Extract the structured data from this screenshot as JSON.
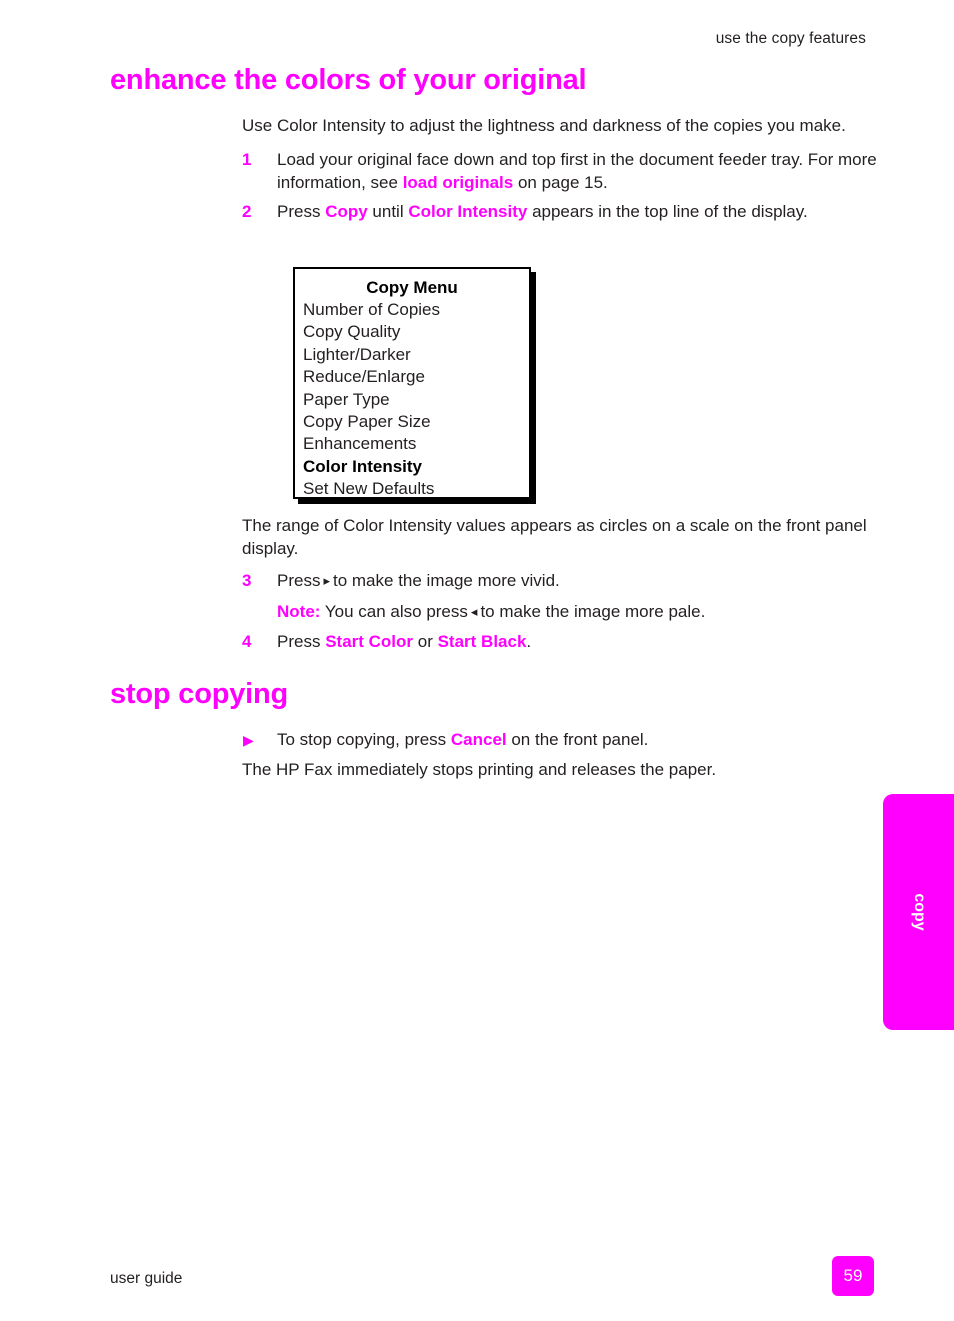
{
  "theme": {
    "accent": "#ff00ff",
    "text": "#231f20",
    "page_bg": "#ffffff"
  },
  "header": {
    "running_head": "use the copy features"
  },
  "sections": {
    "enhance": {
      "heading": "enhance the colors of your original",
      "intro": "Use Color Intensity to adjust the lightness and darkness of the copies you make.",
      "steps": [
        {
          "number": "1",
          "text_before": "Load your original face down and top first in the document feeder tray. For more information, see ",
          "link": "load originals",
          "text_after": " on page 15."
        },
        {
          "number": "2",
          "text_before": "Press ",
          "emph1": "Copy",
          "text_mid": " until ",
          "emph2": "Color Intensity",
          "text_after": " appears in the top line of the display."
        }
      ],
      "after_box_para": "The range of Color Intensity values appears as circles on a scale on the front panel display.",
      "step3": {
        "number": "3",
        "text_before": "Press",
        "arrow_icon": "▸",
        "text_after": "to make the image more vivid."
      },
      "note": {
        "label": "Note:",
        "text_before": " You can also press",
        "arrow_icon": "◂",
        "text_after": "to make the image more pale."
      },
      "step4": {
        "number": "4",
        "text_before": "Press ",
        "emph1": "Start Color",
        "text_mid": " or ",
        "emph2": "Start Black",
        "text_after": "."
      }
    },
    "stop": {
      "heading": "stop copying",
      "bullet": {
        "marker": "▶",
        "text_before": "To stop copying, press ",
        "emph": "Cancel",
        "text_after": " on the front panel."
      },
      "closing": "The HP Fax immediately stops printing and releases the paper."
    }
  },
  "callout": {
    "title": "Copy Menu",
    "items": [
      {
        "label": "Number of Copies",
        "selected": false
      },
      {
        "label": "Copy Quality",
        "selected": false
      },
      {
        "label": "Lighter/Darker",
        "selected": false
      },
      {
        "label": "Reduce/Enlarge",
        "selected": false
      },
      {
        "label": "Paper Type",
        "selected": false
      },
      {
        "label": "Copy Paper Size",
        "selected": false
      },
      {
        "label": "Enhancements",
        "selected": false
      },
      {
        "label": "Color Intensity",
        "selected": true
      },
      {
        "label": "Set New Defaults",
        "selected": false
      }
    ]
  },
  "thumb_tab": {
    "label": "copy"
  },
  "footer": {
    "left_text": "user guide",
    "page_number": "59"
  }
}
